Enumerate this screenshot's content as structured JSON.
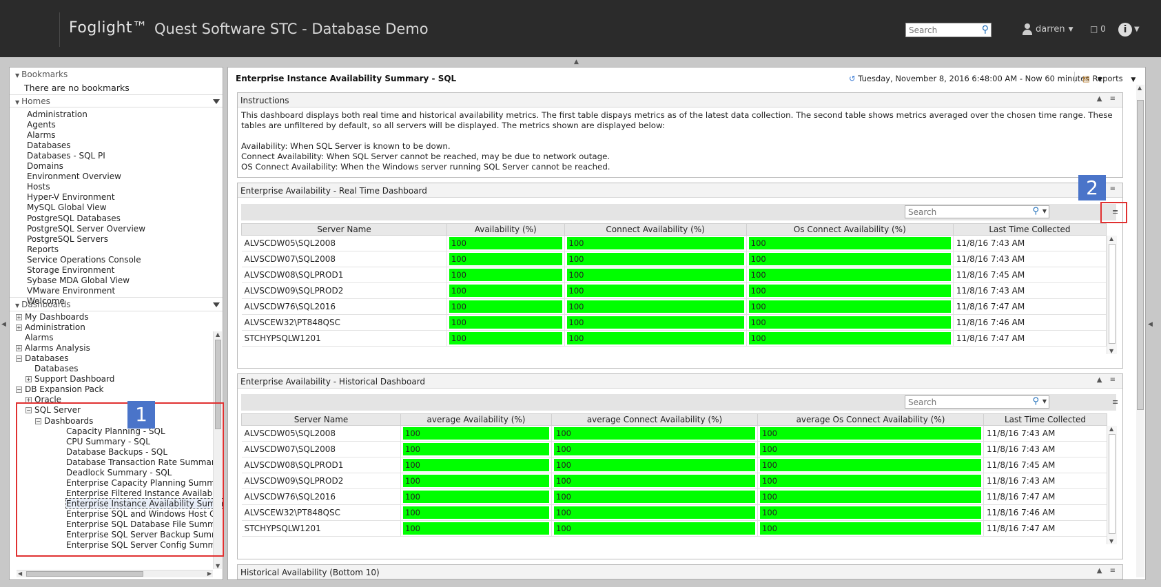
{
  "header": {
    "brand": "Foglight™",
    "title": "Quest Software STC - Database Demo",
    "search_placeholder": "Search",
    "user": "darren",
    "message_count": "0",
    "info_label": "i"
  },
  "left": {
    "bookmarks": {
      "title": "Bookmarks",
      "empty": "There are no bookmarks"
    },
    "homes": {
      "title": "Homes",
      "items": [
        "Administration",
        "Agents",
        "Alarms",
        "Databases",
        "Databases - SQL PI",
        "Domains",
        "Environment Overview",
        "Hosts",
        "Hyper-V Environment",
        "MySQL Global View",
        "PostgreSQL Databases",
        "PostgreSQL Server Overview",
        "PostgreSQL Servers",
        "Reports",
        "Service Operations Console",
        "Storage Environment",
        "Sybase MDA Global View",
        "VMware Environment",
        "Welcome"
      ]
    },
    "dashboards": {
      "title": "Dashboards",
      "tree": [
        {
          "label": "My Dashboards",
          "level": 0,
          "toggle": "+"
        },
        {
          "label": "Administration",
          "level": 0,
          "toggle": "+"
        },
        {
          "label": "Alarms",
          "level": 0,
          "toggle": ""
        },
        {
          "label": "Alarms Analysis",
          "level": 0,
          "toggle": "+"
        },
        {
          "label": "Databases",
          "level": 0,
          "toggle": "-"
        },
        {
          "label": "Databases",
          "level": 1,
          "toggle": ""
        },
        {
          "label": "Support Dashboard",
          "level": 1,
          "toggle": "+"
        },
        {
          "label": "DB Expansion Pack",
          "level": 0,
          "toggle": "-"
        },
        {
          "label": "Oracle",
          "level": 1,
          "toggle": "+"
        },
        {
          "label": "SQL Server",
          "level": 1,
          "toggle": "-"
        },
        {
          "label": "Dashboards",
          "level": 2,
          "toggle": "-"
        },
        {
          "label": "Capacity Planning - SQL",
          "level": 4,
          "toggle": ""
        },
        {
          "label": "CPU Summary - SQL",
          "level": 4,
          "toggle": ""
        },
        {
          "label": "Database Backups - SQL",
          "level": 4,
          "toggle": ""
        },
        {
          "label": "Database Transaction Rate Summary",
          "level": 4,
          "toggle": ""
        },
        {
          "label": "Deadlock Summary - SQL",
          "level": 4,
          "toggle": ""
        },
        {
          "label": "Enterprise Capacity Planning Summa",
          "level": 4,
          "toggle": ""
        },
        {
          "label": "Enterprise Filtered Instance Availabili",
          "level": 4,
          "toggle": ""
        },
        {
          "label": "Enterprise Instance Availability Summ",
          "level": 4,
          "toggle": "",
          "selected": true
        },
        {
          "label": "Enterprise SQL and Windows Host Co",
          "level": 4,
          "toggle": ""
        },
        {
          "label": "Enterprise SQL Database File Summa",
          "level": 4,
          "toggle": ""
        },
        {
          "label": "Enterprise SQL Server Backup Summ",
          "level": 4,
          "toggle": ""
        },
        {
          "label": "Enterprise SQL Server Config Summa",
          "level": 4,
          "toggle": ""
        }
      ]
    }
  },
  "main": {
    "title": "Enterprise Instance Availability Summary - SQL",
    "time_range": "Tuesday, November 8, 2016 6:48:00 AM - Now 60 minutes",
    "reports_label": "Reports",
    "instructions": {
      "title": "Instructions",
      "text1": "This dashboard displays both real time and historical availability metrics. The first table dispays metrics as of the latest data collection. The second table shows metrics averaged over the chosen time range. These tables are unfiltered by default, so all servers will be displayed. The metrics shown are displayed below:",
      "text2": "Availability: When SQL Server is known to be down.",
      "text3": "Connect Availability: When SQL Server cannot be reached, may be due to network outage.",
      "text4": "OS Connect Availability: When the Windows server running SQL Server cannot be reached."
    },
    "realtime": {
      "title": "Enterprise Availability - Real Time Dashboard",
      "search_placeholder": "Search",
      "columns": [
        "Server Name",
        "Availability (%)",
        "Connect Availability (%)",
        "Os Connect Availability (%)",
        "Last Time Collected"
      ],
      "rows": [
        [
          "ALVSCDW05\\SQL2008",
          "100",
          "100",
          "100",
          "11/8/16 7:43 AM"
        ],
        [
          "ALVSCDW07\\SQL2008",
          "100",
          "100",
          "100",
          "11/8/16 7:43 AM"
        ],
        [
          "ALVSCDW08\\SQLPROD1",
          "100",
          "100",
          "100",
          "11/8/16 7:45 AM"
        ],
        [
          "ALVSCDW09\\SQLPROD2",
          "100",
          "100",
          "100",
          "11/8/16 7:43 AM"
        ],
        [
          "ALVSCDW76\\SQL2016",
          "100",
          "100",
          "100",
          "11/8/16 7:47 AM"
        ],
        [
          "ALVSCEW32\\PT848QSC",
          "100",
          "100",
          "100",
          "11/8/16 7:46 AM"
        ],
        [
          "STCHYPSQLW1201",
          "100",
          "100",
          "100",
          "11/8/16 7:47 AM"
        ]
      ]
    },
    "historical": {
      "title": "Enterprise Availability - Historical Dashboard",
      "search_placeholder": "Search",
      "columns": [
        "Server Name",
        "average Availability (%)",
        "average Connect Availability (%)",
        "average Os Connect Availability (%)",
        "Last Time Collected"
      ],
      "rows": [
        [
          "ALVSCDW05\\SQL2008",
          "100",
          "100",
          "100",
          "11/8/16 7:43 AM"
        ],
        [
          "ALVSCDW07\\SQL2008",
          "100",
          "100",
          "100",
          "11/8/16 7:43 AM"
        ],
        [
          "ALVSCDW08\\SQLPROD1",
          "100",
          "100",
          "100",
          "11/8/16 7:45 AM"
        ],
        [
          "ALVSCDW09\\SQLPROD2",
          "100",
          "100",
          "100",
          "11/8/16 7:43 AM"
        ],
        [
          "ALVSCDW76\\SQL2016",
          "100",
          "100",
          "100",
          "11/8/16 7:47 AM"
        ],
        [
          "ALVSCEW32\\PT848QSC",
          "100",
          "100",
          "100",
          "11/8/16 7:46 AM"
        ],
        [
          "STCHYPSQLW1201",
          "100",
          "100",
          "100",
          "11/8/16 7:47 AM"
        ]
      ]
    },
    "bottom_panel_title": "Historical Availability (Bottom 10)"
  },
  "annotations": {
    "badge1": "1",
    "badge2": "2"
  },
  "colors": {
    "availability_bar": "#00ff00",
    "annotation_box": "#e03030",
    "annotation_badge": "#4a74c9",
    "header_bg": "#2b2b2b"
  }
}
